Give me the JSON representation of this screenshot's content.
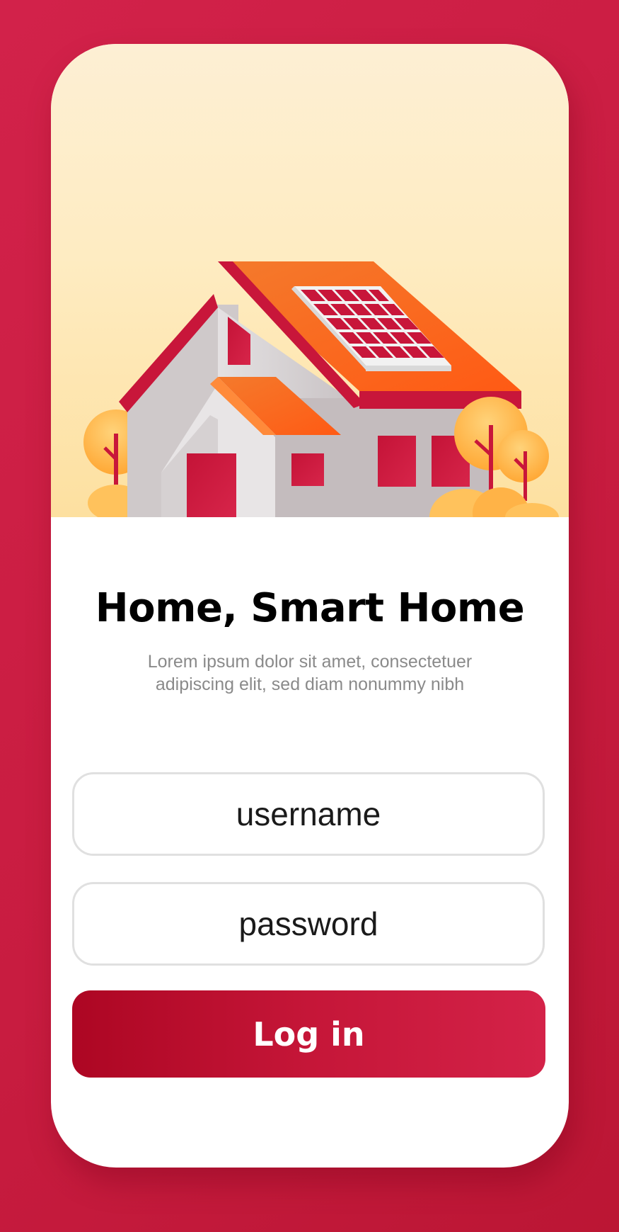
{
  "screen": {
    "title": "Home, Smart Home",
    "subtitle": "Lorem ipsum dolor sit amet, consectetuer adipiscing elit, sed diam nonummy nibh"
  },
  "form": {
    "username_placeholder": "username",
    "password_placeholder": "password",
    "login_label": "Log in"
  },
  "colors": {
    "background": "#c81c40",
    "accent": "#c51638",
    "roof": "#ff6a1a",
    "sky_top": "#fdefd4",
    "sky_bottom": "#fde0a0"
  },
  "icons": {
    "hero": "smart-house-with-solar-panel-illustration"
  }
}
